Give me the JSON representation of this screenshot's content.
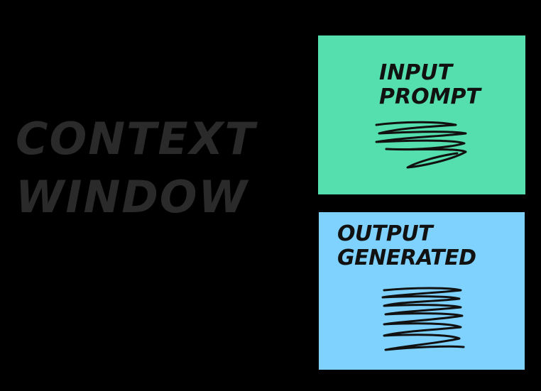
{
  "diagram": {
    "background_color": "#000000",
    "label": {
      "line1": "CONTEXT",
      "line2": "WINDOW",
      "color": "#2a2a2a"
    },
    "input_box": {
      "title_line1": "INPUT",
      "title_line2": "PROMPT",
      "fill_color": "#55dfae",
      "icon": "scribble-lines-icon"
    },
    "output_box": {
      "title_line1": "OUTPUT",
      "title_line2": "GENERATED",
      "fill_color": "#7fd2fd",
      "icon": "scribble-lines-icon"
    }
  }
}
